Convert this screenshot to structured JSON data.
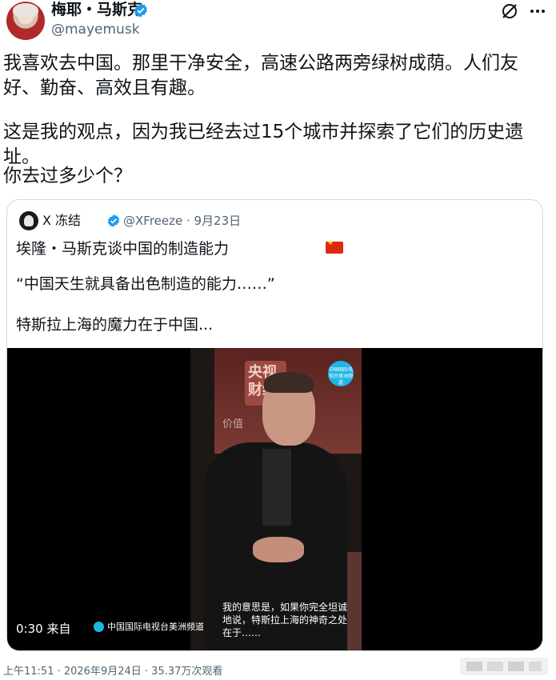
{
  "author": {
    "display_name": "梅耶・马斯克",
    "handle": "@mayemusk"
  },
  "tweet": {
    "paragraphs": [
      "我喜欢去中国。那里干净安全，高速公路两旁绿树成荫。人们友好、勤奋、高效且有趣。",
      "这是我的观点，因为我已经去过15个城市并探索了它们的历史遗址。",
      "你去过多少个？"
    ]
  },
  "quoted": {
    "display_name": "X 冻结",
    "handle_date": "@XFreeze · 9月23日",
    "lines": [
      "埃隆・马斯克谈中国的制造能力",
      "“中国天生就具备出色制造的能力……”",
      "特斯拉上海的魔力在于中国..."
    ],
    "video": {
      "duration_label": "0:30 来自",
      "channel": "中国国际电视台美洲频道",
      "sign_text": "央视 财经",
      "backdrop_text": "价值",
      "logo_text": "中国国际电视台美洲频道",
      "subtitle": "我的意思是，如果你完全坦诚地说，特斯拉上海的神奇之处在于……"
    }
  },
  "footer": {
    "meta": "上午11:51 · 2026年9月24日 · 35.37万次观看"
  },
  "colors": {
    "verified": "#1d9bf0",
    "secondary_text": "#536471",
    "border": "#cfd9de"
  },
  "icons": [
    "verified-badge-icon",
    "grok-icon",
    "more-icon",
    "china-flag-icon"
  ]
}
